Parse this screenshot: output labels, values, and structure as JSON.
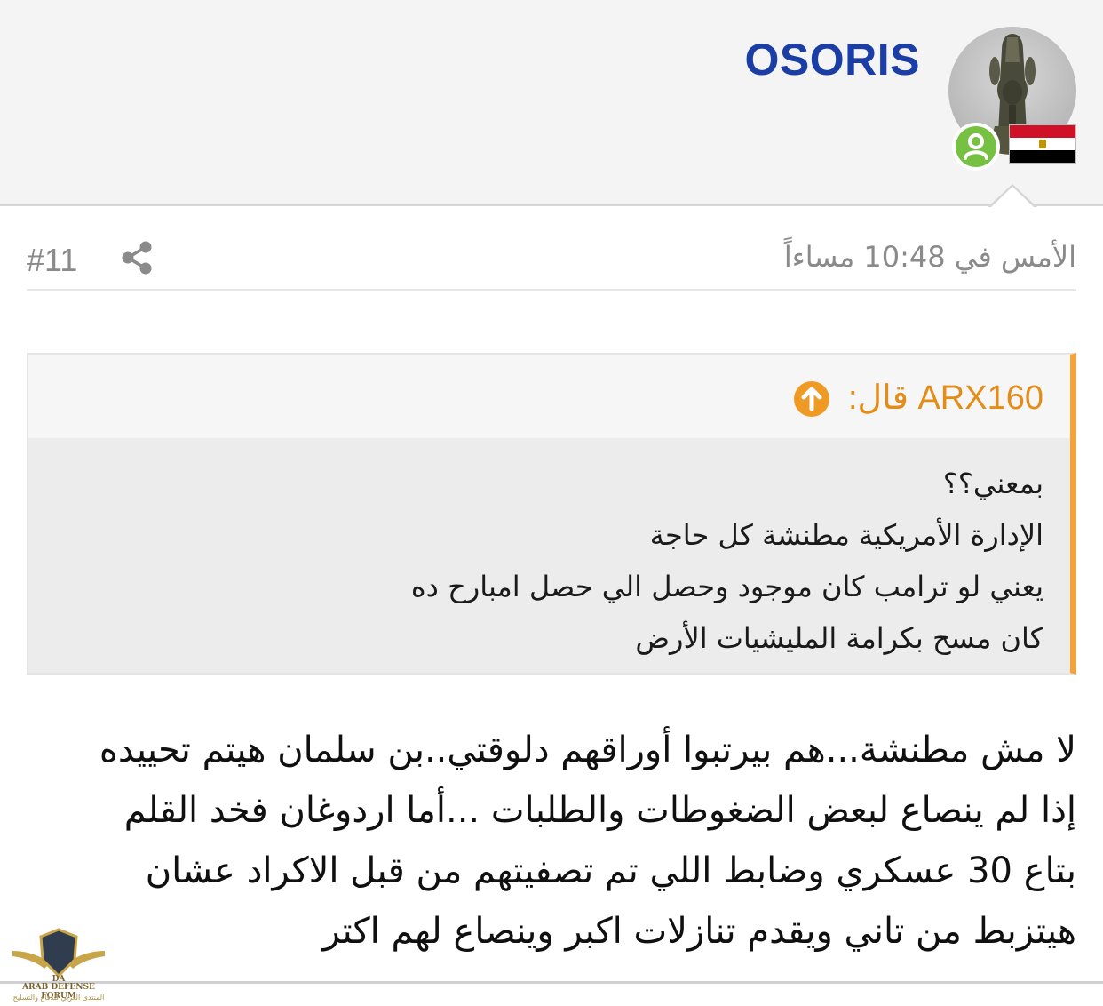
{
  "post": {
    "username": "OSORIS",
    "avatar_icon": "osiris-statue-avatar",
    "flag_icon": "egypt-flag-icon",
    "status_icon": "online-user-icon",
    "date": "الأمس في 10:48 مساءاً",
    "number": "#11",
    "share_icon": "share-icon"
  },
  "quote": {
    "author": "ARX160 قال:",
    "lines": [
      "بمعني؟؟",
      "الإدارة الأمريكية مطنشة كل حاجة",
      "يعني لو ترامب كان موجود وحصل الي حصل امبارح ده",
      "كان مسح بكرامة المليشيات الأرض"
    ]
  },
  "message": {
    "lines": [
      "لا مش مطنشة...هم بيرتبوا أوراقهم دلوقتي..بن سلمان هيتم تحييده",
      "إذا لم ينصاع لبعض الضغوطات والطلبات ...أما اردوغان فخد القلم",
      "بتاع 30 عسكري وضابط اللي تم تصفيتهم من قبل الاكراد عشان",
      "هيتزبط من تاني ويقدم تنازلات اكبر وينصاع لهم اكتر"
    ]
  },
  "watermark": {
    "initials": "DA",
    "title": "ARAB DEFENSE FORUM",
    "subtitle": "المنتدى العربي للدفاع والتسليح"
  },
  "colors": {
    "username": "#1b3ea6",
    "quote_accent": "#f2a33a",
    "online": "#77c142",
    "meta_text": "#8a8a8a"
  }
}
